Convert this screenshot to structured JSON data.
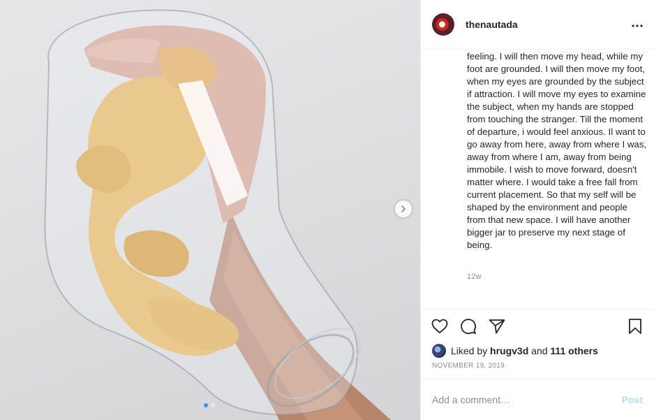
{
  "header": {
    "username": "thenautada"
  },
  "caption": {
    "text": "feeling. I will then move my head, while my foot are grounded. I will then move my foot, when my eyes are grounded by the subject if attraction. I will move my eyes to examine the subject, when my hands are stopped from touching the stranger. Till the moment of departure, i would feel anxious. Il want to go away from here, away from where I was, away from where I am, away from being immobile. I wish to move forward, doesn't matter where. I would take a free fall from current placement. So that my self will be shaped by the environment and people from that new space. I will have another bigger jar to preserve my next stage of being.",
    "time_ago": "12w"
  },
  "likes": {
    "prefix": "Liked by",
    "liker": "hrugv3d",
    "and": "and",
    "others": "111 others"
  },
  "date": "NOVEMBER 19, 2019",
  "comment": {
    "placeholder": "Add a comment…",
    "post_label": "Post"
  },
  "icons": {
    "like": "heart-icon",
    "comment": "speech-bubble-icon",
    "share": "paper-plane-icon",
    "save": "bookmark-icon",
    "more": "ellipsis-icon",
    "next": "chevron-right-icon"
  }
}
